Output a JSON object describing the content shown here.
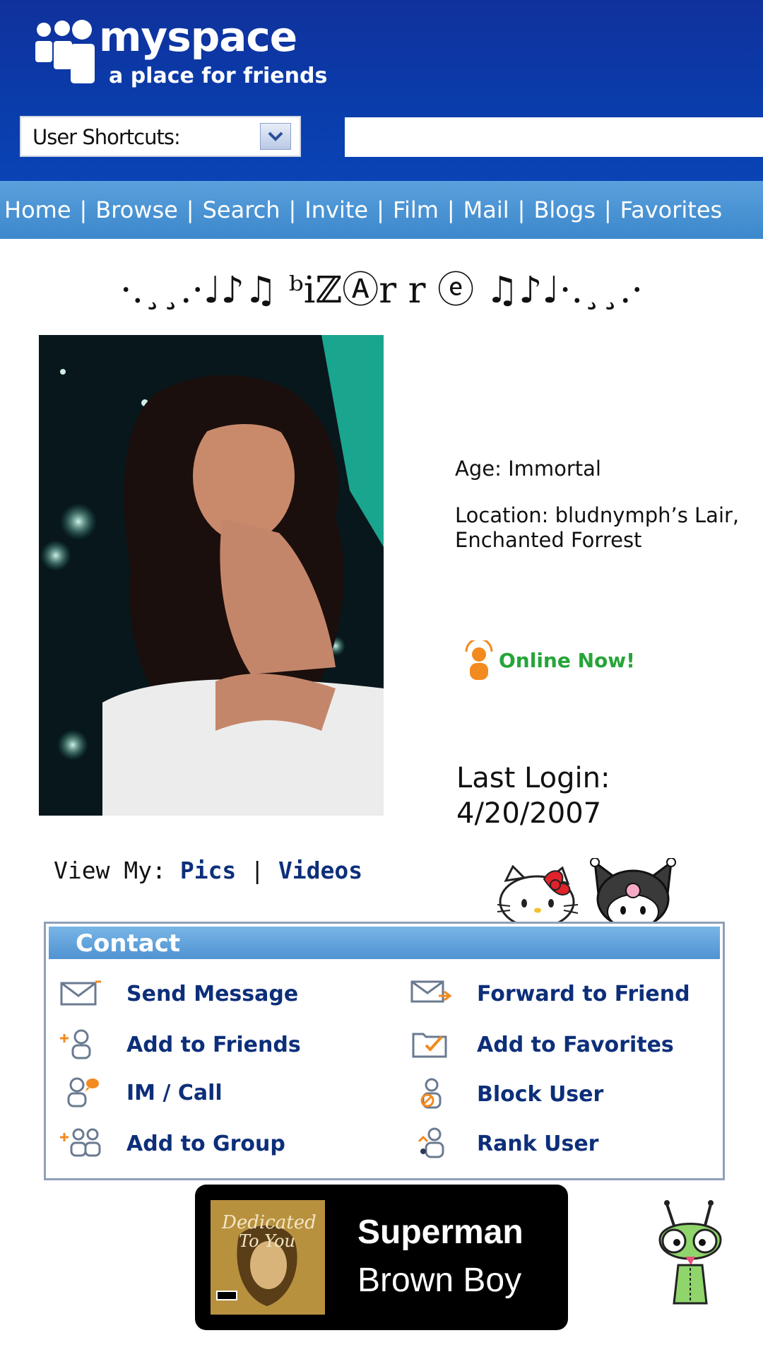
{
  "header": {
    "logo_text": "myspace",
    "tagline": "a place for friends",
    "shortcut_label": "User Shortcuts:",
    "search_value": ""
  },
  "nav": {
    "items": [
      "Home",
      "Browse",
      "Search",
      "Invite",
      "Film",
      "Mail",
      "Blogs",
      "Favorites"
    ]
  },
  "profile": {
    "display_name": "·.¸¸.·♩♪♫ ᵇiℤⒶr r ⓔ ♫♪♩·.¸¸.·",
    "age_label": "Age: Immortal",
    "location_line1": "Location: bludnymph’s Lair,",
    "location_line2": "Enchanted Forrest",
    "online_status": "Online Now!",
    "last_login_label": "Last Login:",
    "last_login_date": "4/20/2007",
    "view_my_label": "View My:",
    "pics_link": "Pics",
    "videos_link": "Videos"
  },
  "contact": {
    "title": "Contact",
    "items": [
      {
        "label": "Send Message",
        "icon": "envelope-icon"
      },
      {
        "label": "Forward to Friend",
        "icon": "forward-envelope-icon"
      },
      {
        "label": "Add to Friends",
        "icon": "add-friend-icon"
      },
      {
        "label": "Add to Favorites",
        "icon": "favorites-folder-icon"
      },
      {
        "label": "IM / Call",
        "icon": "im-call-icon"
      },
      {
        "label": "Block User",
        "icon": "block-user-icon"
      },
      {
        "label": "Add to Group",
        "icon": "add-group-icon"
      },
      {
        "label": "Rank User",
        "icon": "rank-user-icon"
      }
    ]
  },
  "now_playing": {
    "song": "Superman",
    "artist": "Brown Boy",
    "album_art_text_line1": "Dedicated",
    "album_art_text_line2": "To You"
  },
  "colors": {
    "header_blue": "#0b3aa8",
    "nav_blue": "#4a93d4",
    "link_blue": "#0d2f7a",
    "online_green": "#26a539"
  }
}
